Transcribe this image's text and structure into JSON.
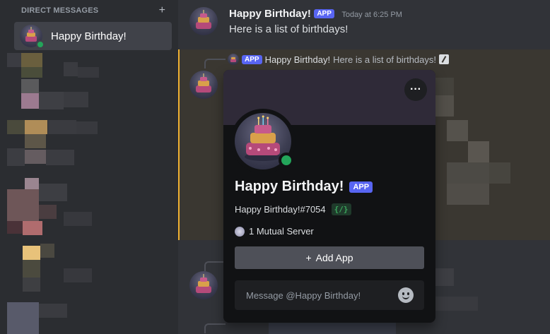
{
  "sidebar": {
    "section_label": "DIRECT MESSAGES",
    "add_icon": "plus-icon",
    "dm_item": {
      "label": "Happy Birthday!",
      "status": "online"
    }
  },
  "messages": [
    {
      "author": "Happy Birthday!",
      "badge": "APP",
      "timestamp": "Today at 6:25 PM",
      "text": "Here is a list of birthdays!"
    }
  ],
  "reply": {
    "badge": "APP",
    "author": "Happy Birthday!",
    "text": "Here is a list of birthdays!",
    "icon": "slash-command-icon"
  },
  "popout": {
    "more_label": "···",
    "name": "Happy Birthday!",
    "badge": "APP",
    "tag": "Happy Birthday!#7054",
    "slash_badge": "{/}",
    "mutual": "1 Mutual Server",
    "add_button": "Add App",
    "add_icon_glyph": "+",
    "message_placeholder": "Message @Happy Birthday!"
  },
  "colors": {
    "accent": "#5865f2",
    "online": "#23a55a",
    "highlight_border": "#f0b232"
  }
}
